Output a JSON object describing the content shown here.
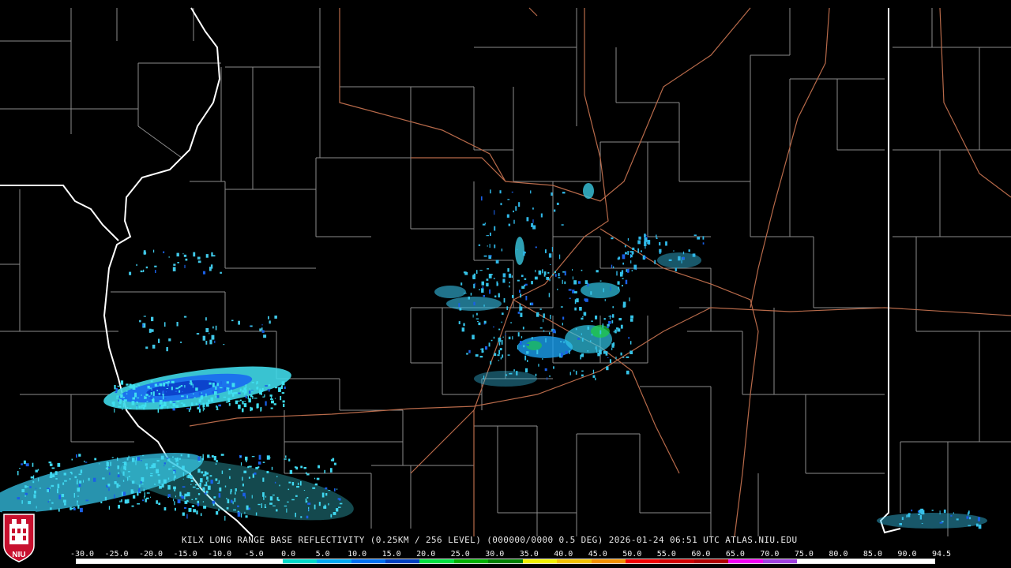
{
  "product_caption": "KILX LONG RANGE BASE REFLECTIVITY (0.25KM / 256 LEVEL) (000000/0000 0.5 DEG) 2026-01-24 06:51 UTC  ATLAS.NIU.EDU",
  "logo_text": "NIU",
  "colorbar": {
    "labels": [
      "-30.0",
      "-25.0",
      "-20.0",
      "-15.0",
      "-10.0",
      "-5.0",
      "0.0",
      "5.0",
      "10.0",
      "15.0",
      "20.0",
      "25.0",
      "30.0",
      "35.0",
      "40.0",
      "45.0",
      "50.0",
      "55.0",
      "60.0",
      "65.0",
      "70.0",
      "75.0",
      "80.0",
      "85.0",
      "90.0",
      "94.5"
    ],
    "colors": [
      "#ffffff",
      "#ffffff",
      "#ffffff",
      "#ffffff",
      "#ffffff",
      "#ffffff",
      "#00d8c8",
      "#00a8f0",
      "#0070f0",
      "#0040c0",
      "#00e040",
      "#00b000",
      "#008000",
      "#f0f000",
      "#f0c000",
      "#f09000",
      "#f00000",
      "#d00000",
      "#b00000",
      "#f000f0",
      "#a040e0",
      "#ffffff",
      "#ffffff",
      "#ffffff",
      "#ffffff"
    ]
  },
  "map_colors": {
    "county_lines": "#8c8c8c",
    "state_lines": "#ffffff",
    "highways": "#b86a4a"
  }
}
